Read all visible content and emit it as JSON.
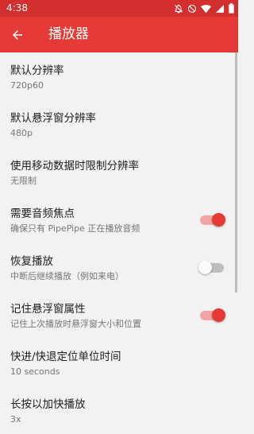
{
  "status_bar": {
    "time": "4:38",
    "icons": [
      "notifications-off-icon",
      "do-not-disturb-icon",
      "wifi-icon",
      "signal-icon",
      "battery-icon"
    ]
  },
  "toolbar": {
    "title": "播放器",
    "back_icon": "arrow-back-icon",
    "background": "#e53935"
  },
  "colors": {
    "accent": "#e53935",
    "status_bar": "#d32f2f",
    "background": "#f2f2f2"
  },
  "settings": [
    {
      "title": "默认分辨率",
      "summary": "720p60"
    },
    {
      "title": "默认悬浮窗分辨率",
      "summary": "480p"
    },
    {
      "title": "使用移动数据时限制分辨率",
      "summary": "无限制"
    },
    {
      "title": "需要音频焦点",
      "summary": "确保只有 PipePipe 正在播放音频",
      "switch_on": true
    },
    {
      "title": "恢复播放",
      "summary": "中断后继续播放（例如来电）",
      "switch_on": false
    },
    {
      "title": "记住悬浮窗属性",
      "summary": "记住上次播放时悬浮窗大小和位置",
      "switch_on": true
    },
    {
      "title": "快进/快退定位单位时间",
      "summary": "10 seconds"
    },
    {
      "title": "长按以加快播放",
      "summary": "3x"
    }
  ]
}
